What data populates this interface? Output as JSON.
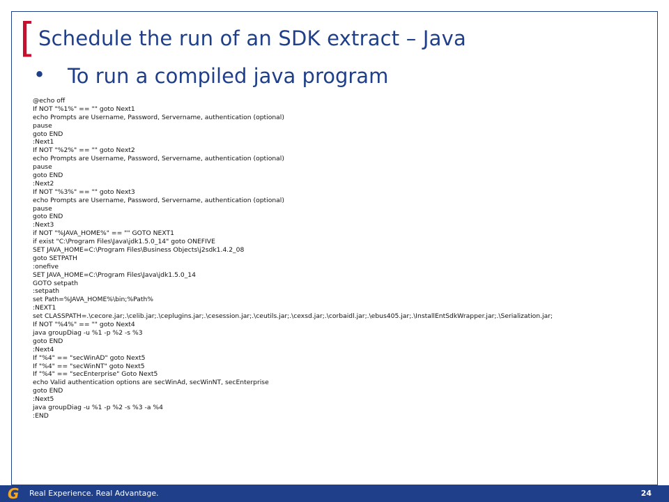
{
  "slide": {
    "title": "Schedule the run of an SDK extract – Java",
    "bracket": "[",
    "bullet_symbol": "•",
    "bullet": "To run a compiled java program",
    "code_lines": [
      "@echo off",
      "If NOT \"%1%\" == \"\" goto Next1",
      "echo Prompts are Username, Password, Servername, authentication (optional)",
      "pause",
      "goto END",
      ":Next1",
      "If NOT \"%2%\" == \"\" goto Next2",
      "echo Prompts are Username, Password, Servername, authentication (optional)",
      "pause",
      "goto END",
      ":Next2",
      "If NOT \"%3%\" == \"\" goto Next3",
      "echo Prompts are Username, Password, Servername, authentication (optional)",
      "pause",
      "goto END",
      ":Next3",
      "if NOT \"%JAVA_HOME%\" == \"\" GOTO NEXT1",
      "if exist \"C:\\Program Files\\Java\\jdk1.5.0_14\" goto ONEFIVE",
      "SET JAVA_HOME=C:\\Program Files\\Business Objects\\j2sdk1.4.2_08",
      "goto SETPATH",
      ":onefive",
      "SET JAVA_HOME=C:\\Program Files\\Java\\jdk1.5.0_14",
      "GOTO setpath",
      ":setpath",
      "set Path=%JAVA_HOME%\\bin;%Path%",
      ":NEXT1",
      "set CLASSPATH=.\\cecore.jar;.\\celib.jar;.\\ceplugins.jar;.\\cesession.jar;.\\ceutils.jar;.\\cexsd.jar;.\\corbaidl.jar;.\\ebus405.jar;.\\InstallEntSdkWrapper.jar;.\\Serialization.jar;",
      "If NOT \"%4%\" == \"\" goto Next4",
      "java groupDiag -u %1 -p %2 -s %3",
      "goto END",
      ":Next4",
      "If \"%4\" == \"secWinAD\" goto Next5",
      "If \"%4\" == \"secWinNT\" goto Next5",
      "If \"%4\" == \"secEnterprise\" Goto Next5",
      "echo Valid authentication options are secWinAd, secWinNT, secEnterprise",
      "goto END",
      ":Next5",
      "java groupDiag -u %1 -p %2 -s %3 -a %4",
      ":END"
    ]
  },
  "footer": {
    "logo": "G",
    "tagline": "Real Experience. Real Advantage.",
    "page_number": "24"
  },
  "colors": {
    "brand_blue": "#1f3f8a",
    "accent_red": "#c8102e",
    "logo_orange": "#f5a623"
  }
}
